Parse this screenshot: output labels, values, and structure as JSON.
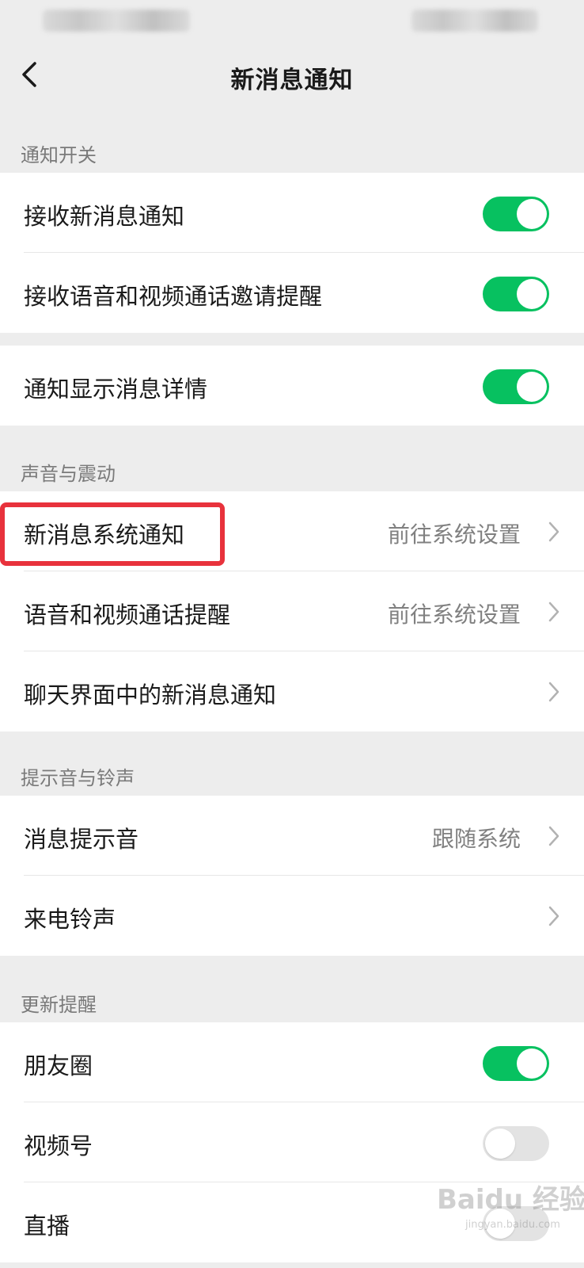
{
  "header": {
    "title": "新消息通知"
  },
  "sections": {
    "notify_switch": "通知开关",
    "sound_vibration": "声音与震动",
    "tone_ringtone": "提示音与铃声",
    "update_reminder": "更新提醒"
  },
  "rows": {
    "receive_new": {
      "label": "接收新消息通知",
      "on": true
    },
    "voice_video_invite": {
      "label": "接收语音和视频通话邀请提醒",
      "on": true
    },
    "show_details": {
      "label": "通知显示消息详情",
      "on": true
    },
    "system_notify": {
      "label": "新消息系统通知",
      "value": "前往系统设置"
    },
    "call_reminder": {
      "label": "语音和视频通话提醒",
      "value": "前往系统设置"
    },
    "chat_notify": {
      "label": "聊天界面中的新消息通知"
    },
    "message_tone": {
      "label": "消息提示音",
      "value": "跟随系统"
    },
    "ringtone": {
      "label": "来电铃声"
    },
    "moments": {
      "label": "朋友圈",
      "on": true
    },
    "channels": {
      "label": "视频号",
      "on": false
    },
    "live": {
      "label": "直播",
      "on": false
    }
  },
  "watermark": {
    "text": "Baidu 经验",
    "sub": "jingyan.baidu.com"
  },
  "colors": {
    "accent_green": "#07c160",
    "highlight_red": "#e8323c",
    "background": "#ededed"
  },
  "icons": {
    "back": "chevron-left-icon",
    "row_arrow": "chevron-right-icon"
  }
}
